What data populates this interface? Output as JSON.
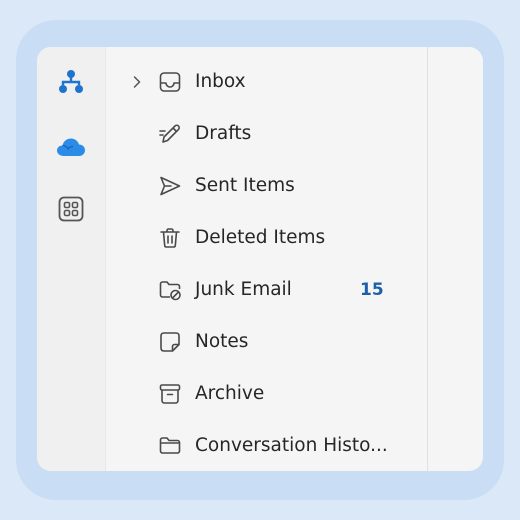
{
  "colors": {
    "outer_background": "#dbe8f7",
    "frame": "#c9def4",
    "window": "#f5f5f5",
    "rail": "#f0f0f0",
    "accent_count": "#1f5fa8",
    "text": "#262626",
    "icon_stroke": "#4a4a4a",
    "org_icon": "#1e73cf",
    "cloud_icon": "#2b8ce8"
  },
  "rail": {
    "items": [
      {
        "icon": "org-chart-icon"
      },
      {
        "icon": "onedrive-cloud-icon"
      },
      {
        "icon": "apps-grid-icon"
      }
    ]
  },
  "folders": [
    {
      "label": "Inbox",
      "icon": "inbox-icon",
      "expandable": true,
      "count": ""
    },
    {
      "label": "Drafts",
      "icon": "drafts-pencil-icon",
      "expandable": false,
      "count": ""
    },
    {
      "label": "Sent Items",
      "icon": "sent-arrow-icon",
      "expandable": false,
      "count": ""
    },
    {
      "label": "Deleted Items",
      "icon": "trash-icon",
      "expandable": false,
      "count": ""
    },
    {
      "label": "Junk Email",
      "icon": "junk-folder-icon",
      "expandable": false,
      "count": "15"
    },
    {
      "label": "Notes",
      "icon": "note-icon",
      "expandable": false,
      "count": ""
    },
    {
      "label": "Archive",
      "icon": "archive-box-icon",
      "expandable": false,
      "count": ""
    },
    {
      "label": "Conversation Histo...",
      "icon": "folder-icon",
      "expandable": false,
      "count": ""
    }
  ]
}
